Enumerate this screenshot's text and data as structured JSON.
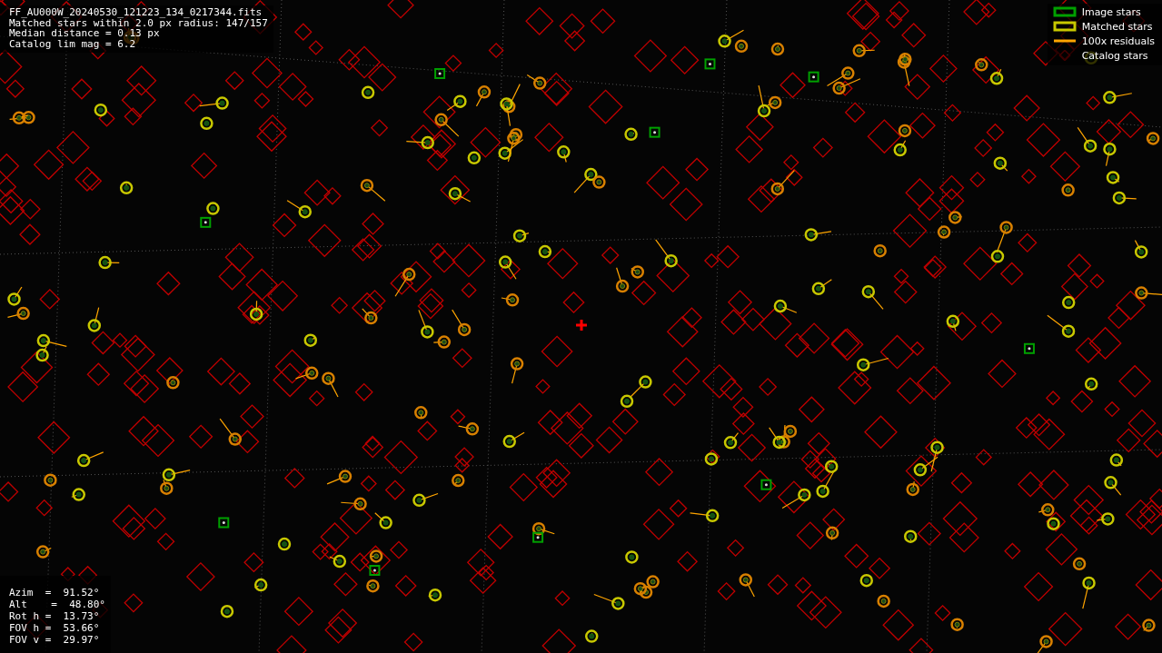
{
  "info": [
    "FF_AU000W_20240530_121223_134_0217344.fits",
    "Matched stars within 2.0 px radius: 147/157",
    "Median distance = 0.13 px",
    "Catalog lim mag = 6.2"
  ],
  "legend": [
    {
      "kind": "box",
      "label": "Image stars",
      "color": "#00a000"
    },
    {
      "kind": "box",
      "label": "Matched stars",
      "color": "#c8c800"
    },
    {
      "kind": "line",
      "label": "100x residuals",
      "color": "#ffa500"
    },
    {
      "kind": "diamond",
      "label": "Catalog stars",
      "color": "#400000"
    }
  ],
  "pointing": [
    "Azim  =  91.52°",
    "Alt    =  48.80°",
    "Rot h =  13.73°",
    "FOV h =  53.66°",
    "FOV v =  29.97°"
  ]
}
